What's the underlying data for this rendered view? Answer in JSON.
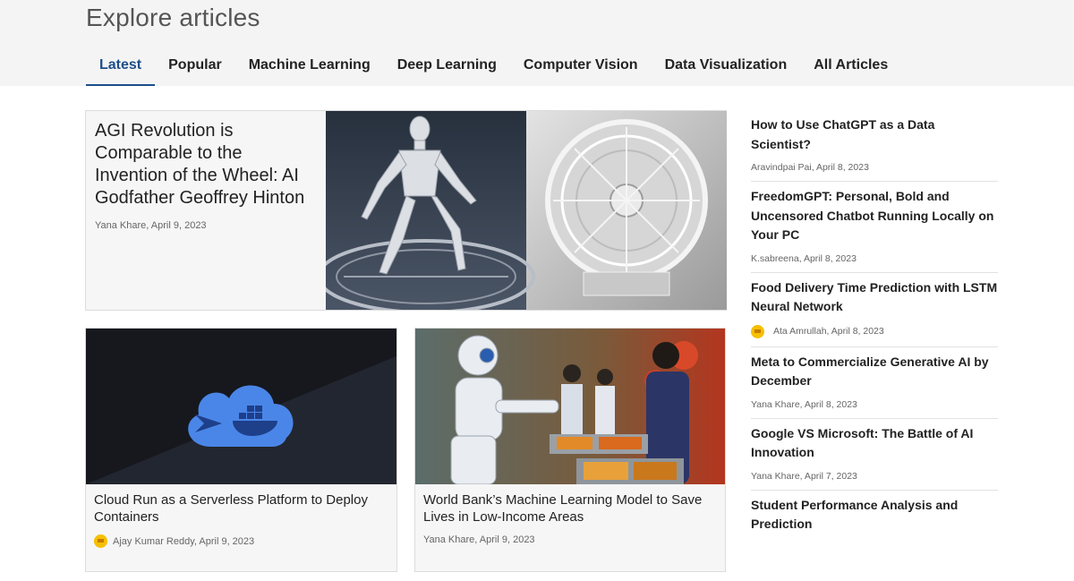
{
  "header": {
    "title": "Explore articles"
  },
  "tabs": [
    {
      "label": "Latest",
      "active": true
    },
    {
      "label": "Popular"
    },
    {
      "label": "Machine Learning"
    },
    {
      "label": "Deep Learning"
    },
    {
      "label": "Computer Vision"
    },
    {
      "label": "Data Visualization"
    },
    {
      "label": "All Articles"
    }
  ],
  "featured": {
    "title": "AGI Revolution is Comparable to the Invention of the Wheel: AI Godfather Geoffrey Hinton",
    "meta": "Yana Khare, April 9, 2023"
  },
  "cards": [
    {
      "title": "Cloud Run as a Serverless Platform to Deploy Containers",
      "meta": "Ajay Kumar Reddy, April 9, 2023"
    },
    {
      "title": "World Bank’s Machine Learning Model to Save Lives in Low-Income Areas",
      "meta": "Yana Khare, April 9, 2023"
    }
  ],
  "sidebar": [
    {
      "title": "How to Use ChatGPT as a Data Scientist?",
      "meta": "Aravindpai Pai, April 8, 2023"
    },
    {
      "title": "FreedomGPT: Personal, Bold and Uncensored Chatbot Running Locally on Your PC",
      "meta": "K.sabreena, April 8, 2023"
    },
    {
      "title": "Food Delivery Time Prediction with LSTM Neural Network",
      "meta": "Ata Amrullah, April 8, 2023"
    },
    {
      "title": "Meta to Commercialize Generative AI by December",
      "meta": "Yana Khare, April 8, 2023"
    },
    {
      "title": "Google VS Microsoft: The Battle of AI Innovation",
      "meta": "Yana Khare, April 7, 2023"
    },
    {
      "title": "Student Performance Analysis and Prediction",
      "meta": ""
    }
  ],
  "colors": {
    "accent": "#1d4e89",
    "badge": "#f5c000",
    "cloud": "#4a86e8"
  },
  "icons": {
    "author_badge": "author-badge-icon",
    "cloud": "cloud-run-docker-icon"
  }
}
